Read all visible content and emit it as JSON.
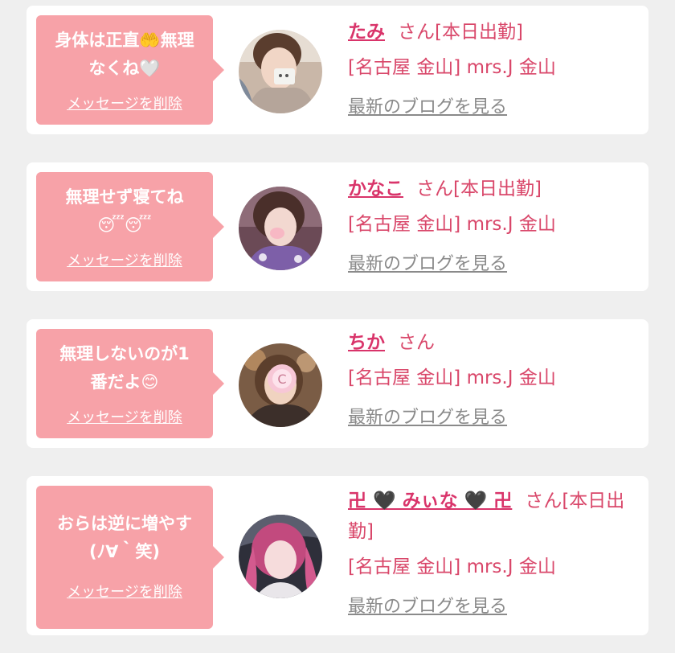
{
  "cards": [
    {
      "message": "身体は正直🤲無理なくね🤍",
      "delete_label": "メッセージを削除",
      "name": "たみ",
      "status": "さん[本日出勤]",
      "store": "[名古屋 金山] mrs.J 金山",
      "blog_link": "最新のブログを見る"
    },
    {
      "message": "無理せず寝てね😴😴",
      "delete_label": "メッセージを削除",
      "name": "かなこ",
      "status": "さん[本日出勤]",
      "store": "[名古屋 金山] mrs.J 金山",
      "blog_link": "最新のブログを見る"
    },
    {
      "message": "無理しないのが1番だよ😊",
      "delete_label": "メッセージを削除",
      "name": "ちか",
      "status": "さん",
      "store": "[名古屋 金山] mrs.J 金山",
      "blog_link": "最新のブログを見る"
    },
    {
      "message": "おらは逆に増やす(ﾉ∀｀笑)",
      "delete_label": "メッセージを削除",
      "name": "卍 🖤 みぃな 🖤 卍",
      "status": "さん[本日出勤]",
      "store": "[名古屋 金山] mrs.J 金山",
      "blog_link": "最新のブログを見る"
    }
  ],
  "colors": {
    "bubble": "#f7a2a8",
    "accent": "#d9346a",
    "link_gray": "#8a8a8a",
    "background": "#efefef"
  }
}
